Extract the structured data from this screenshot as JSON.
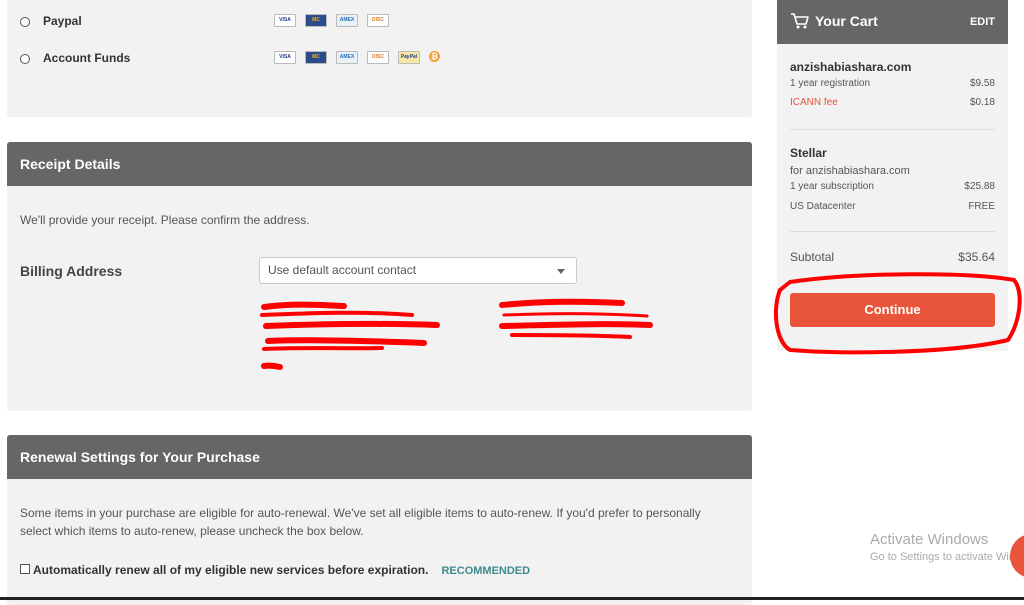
{
  "payment": {
    "options": [
      {
        "label": "Paypal",
        "cards": [
          "VISA",
          "MC",
          "AMEX",
          "DISC"
        ]
      },
      {
        "label": "Account Funds",
        "cards": [
          "VISA",
          "MC",
          "AMEX",
          "DISC",
          "PayPal",
          "BTC"
        ]
      }
    ]
  },
  "receipt": {
    "title": "Receipt Details",
    "intro": "We'll provide your receipt. Please confirm the address.",
    "billing_label": "Billing Address",
    "billing_select": "Use default account contact"
  },
  "renewal": {
    "title": "Renewal Settings for Your Purchase",
    "description": "Some items in your purchase are eligible for auto-renewal. We've set all eligible items to auto-renew. If you'd prefer to personally select which items to auto-renew, please uncheck the box below.",
    "checkbox_label": "Automatically renew all of my eligible new services before expiration.",
    "recommended": "RECOMMENDED"
  },
  "cart": {
    "title": "Your Cart",
    "edit": "EDIT",
    "domain": "anzishabiashara.com",
    "registration_label": "1 year registration",
    "registration_price": "$9.58",
    "icann_label": "ICANN fee",
    "icann_price": "$0.18",
    "product": "Stellar",
    "product_for": "for anzishabiashara.com",
    "subscription_label": "1 year subscription",
    "subscription_price": "$25.88",
    "datacenter_label": "US Datacenter",
    "datacenter_price": "FREE",
    "subtotal_label": "Subtotal",
    "subtotal_price": "$35.64",
    "continue": "Continue"
  },
  "watermark": {
    "line1": "Activate Windows",
    "line2": "Go to Settings to activate Windows."
  },
  "colors": {
    "header_gray": "#666666",
    "panel_bg": "#f2f2f2",
    "accent_orange": "#e8553a",
    "recommended_teal": "#3c8b8c",
    "annotation_red": "#ff0000"
  }
}
